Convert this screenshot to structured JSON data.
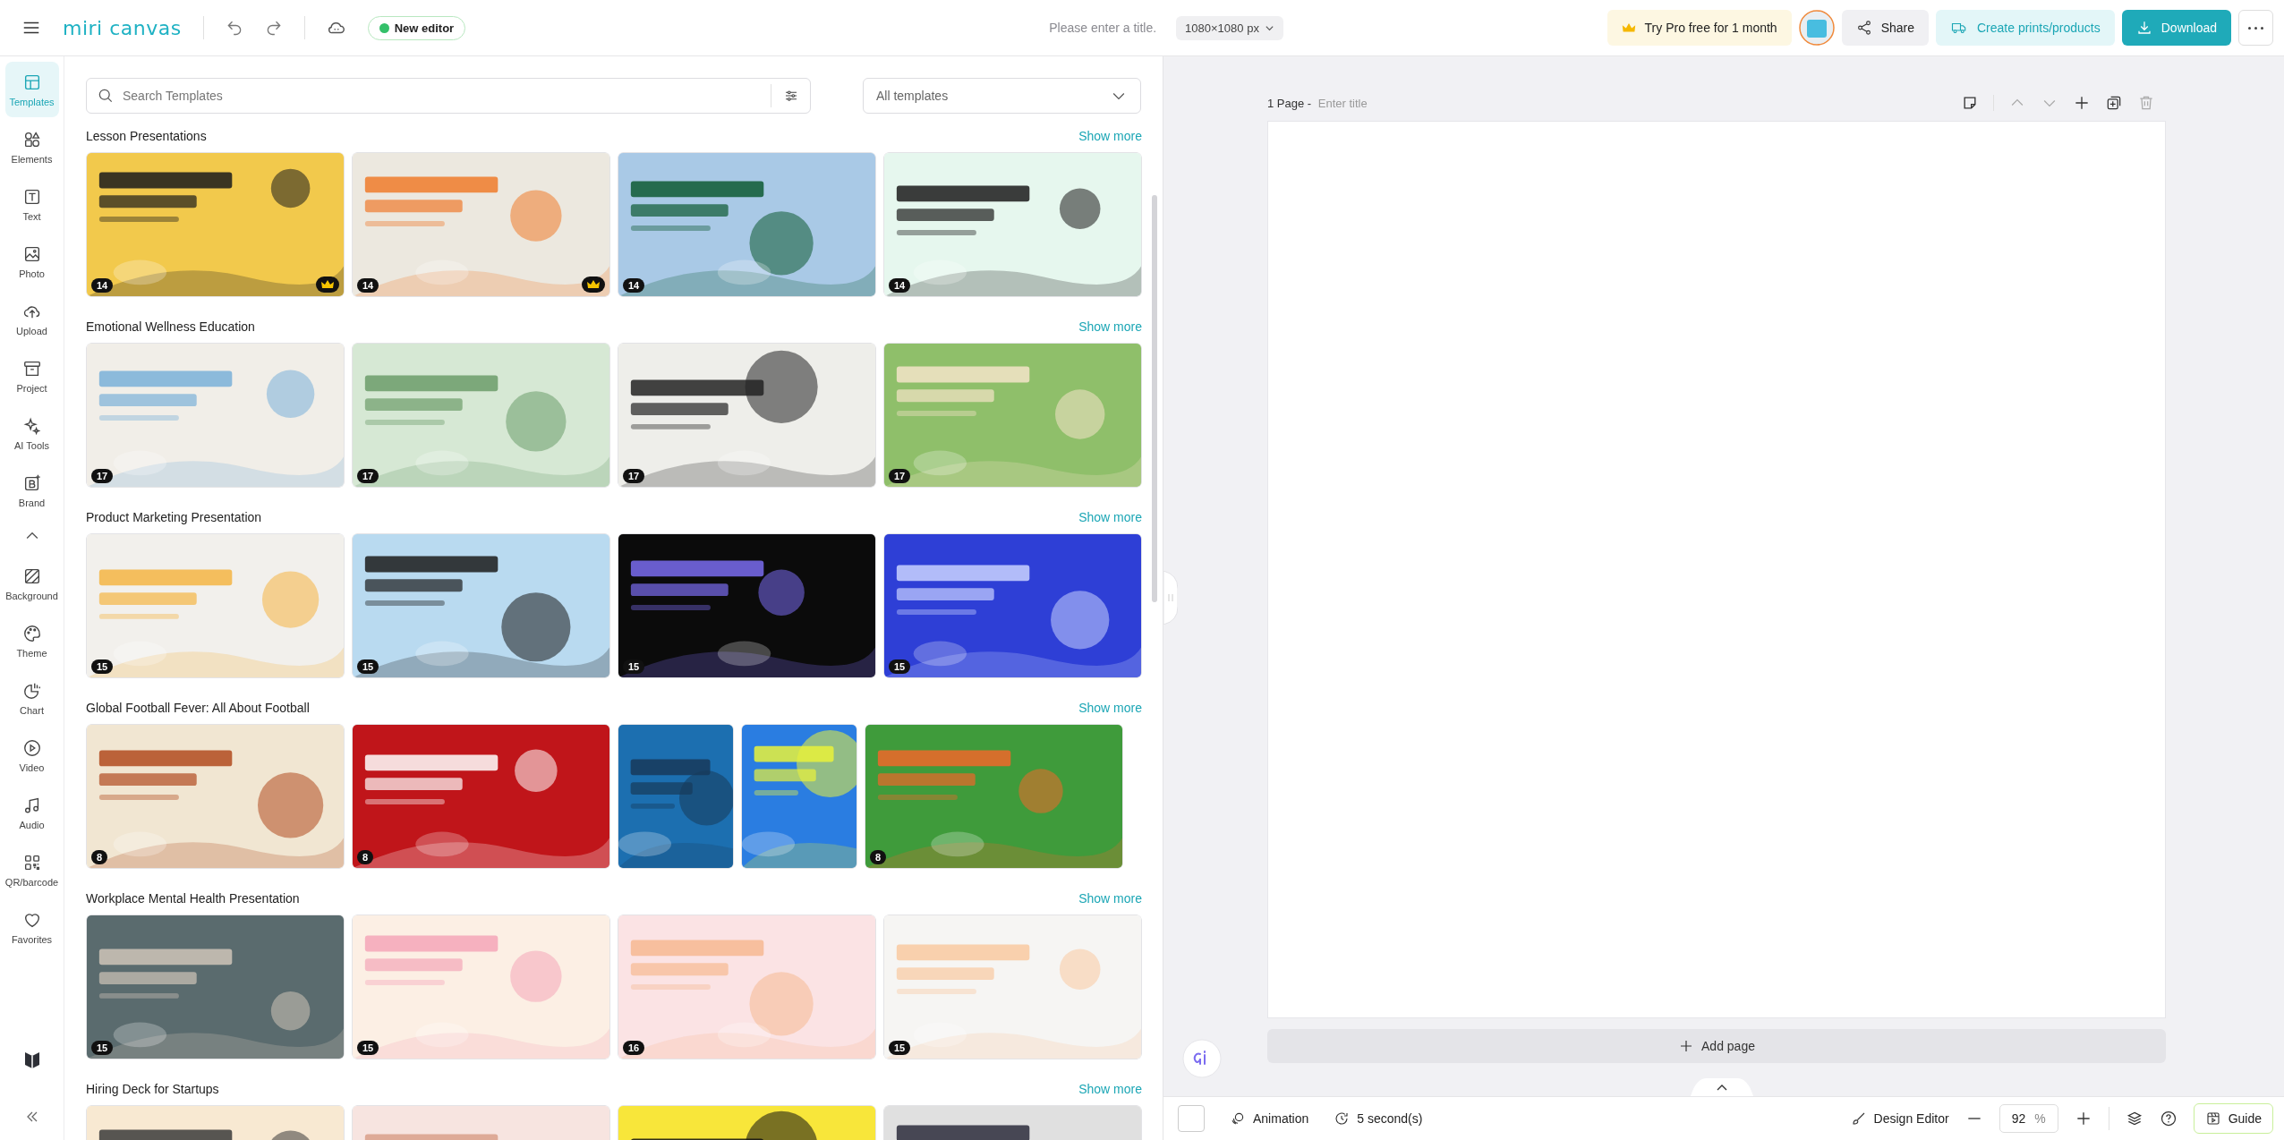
{
  "topbar": {
    "logo": "miri canvas",
    "new_editor": "New editor",
    "title_placeholder": "Please enter a title.",
    "size": "1080×1080 px",
    "pro": "Try Pro free for 1 month",
    "share": "Share",
    "prints": "Create prints/products",
    "download": "Download"
  },
  "sidebar": {
    "items": [
      {
        "label": "Templates",
        "selected": true
      },
      {
        "label": "Elements",
        "selected": false
      },
      {
        "label": "Text",
        "selected": false
      },
      {
        "label": "Photo",
        "selected": false
      },
      {
        "label": "Upload",
        "selected": false
      },
      {
        "label": "Project",
        "selected": false
      },
      {
        "label": "AI Tools",
        "selected": false
      },
      {
        "label": "Brand",
        "selected": false
      },
      {
        "label": "Background",
        "selected": false
      },
      {
        "label": "Theme",
        "selected": false
      },
      {
        "label": "Chart",
        "selected": false
      },
      {
        "label": "Video",
        "selected": false
      },
      {
        "label": "Audio",
        "selected": false
      },
      {
        "label": "QR/barcode",
        "selected": false
      },
      {
        "label": "Favorites",
        "selected": false
      }
    ]
  },
  "search": {
    "placeholder": "Search Templates",
    "filter": "All templates"
  },
  "sections": [
    {
      "title": "Lesson Presentations",
      "more": "Show more",
      "templates": [
        {
          "kind": "landscape",
          "count": "14",
          "premium": true
        },
        {
          "kind": "landscape",
          "count": "14",
          "premium": true
        },
        {
          "kind": "landscape",
          "count": "14",
          "premium": false
        },
        {
          "kind": "landscape",
          "count": "14",
          "premium": false
        }
      ]
    },
    {
      "title": "Emotional Wellness Education",
      "more": "Show more",
      "templates": [
        {
          "kind": "landscape",
          "count": "17",
          "premium": false
        },
        {
          "kind": "landscape",
          "count": "17",
          "premium": false
        },
        {
          "kind": "landscape",
          "count": "17",
          "premium": false
        },
        {
          "kind": "landscape",
          "count": "17",
          "premium": false
        }
      ]
    },
    {
      "title": "Product Marketing Presentation",
      "more": "Show more",
      "templates": [
        {
          "kind": "landscape",
          "count": "15",
          "premium": false
        },
        {
          "kind": "landscape",
          "count": "15",
          "premium": false
        },
        {
          "kind": "landscape",
          "count": "15",
          "premium": false
        },
        {
          "kind": "landscape",
          "count": "15",
          "premium": false
        }
      ]
    },
    {
      "title": "Global Football Fever: All About Football",
      "more": "Show more",
      "templates": [
        {
          "kind": "landscape",
          "count": "8",
          "premium": false
        },
        {
          "kind": "landscape",
          "count": "8",
          "premium": false
        },
        {
          "kind": "portrait",
          "premium": false
        },
        {
          "kind": "portrait",
          "premium": false
        },
        {
          "kind": "landscape",
          "count": "8",
          "premium": false
        }
      ]
    },
    {
      "title": "Workplace Mental Health Presentation",
      "more": "Show more",
      "templates": [
        {
          "kind": "landscape",
          "count": "15",
          "premium": false
        },
        {
          "kind": "landscape",
          "count": "15",
          "premium": false
        },
        {
          "kind": "landscape",
          "count": "16",
          "premium": false
        },
        {
          "kind": "landscape",
          "count": "15",
          "premium": false
        }
      ]
    },
    {
      "title": "Hiring Deck for Startups",
      "more": "Show more",
      "templates": [
        {
          "kind": "landscape"
        },
        {
          "kind": "landscape"
        },
        {
          "kind": "landscape"
        },
        {
          "kind": "landscape"
        }
      ]
    }
  ],
  "page": {
    "label": "1 Page - ",
    "title_placeholder": "Enter title",
    "add_page": "Add page"
  },
  "bottombar": {
    "animation": "Animation",
    "duration": "5 second(s)",
    "design_editor": "Design Editor",
    "zoom": "92",
    "zoom_unit": "%",
    "guide": "Guide"
  }
}
